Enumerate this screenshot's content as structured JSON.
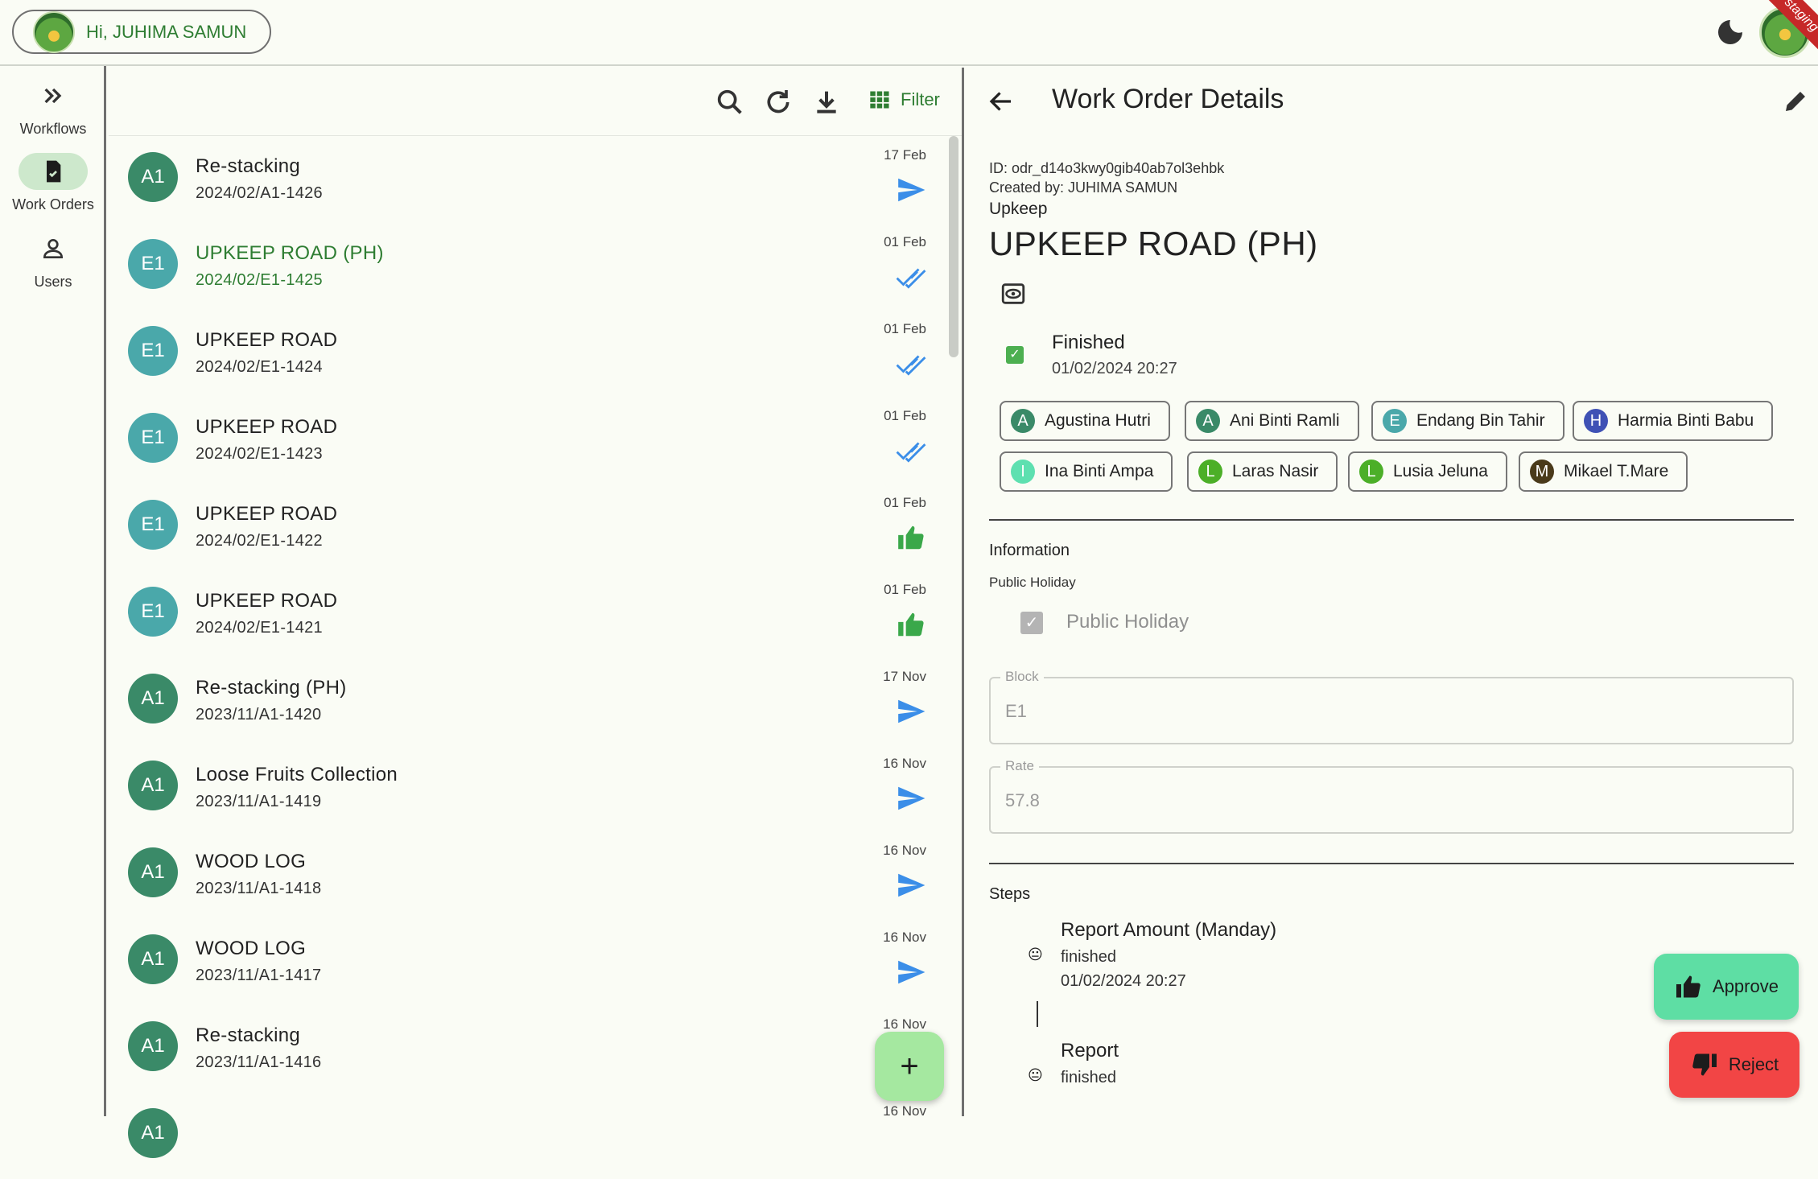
{
  "header": {
    "greeting": "Hi, JUHIMA SAMUN",
    "env_badge": "staging"
  },
  "rail": {
    "items": [
      {
        "label": "Workflows",
        "icon": "double-chevron-right-icon"
      },
      {
        "label": "Work Orders",
        "icon": "clipboard-check-icon",
        "active": true
      },
      {
        "label": "Users",
        "icon": "person-icon"
      }
    ]
  },
  "toolbar": {
    "filter_label": "Filter"
  },
  "orders": [
    {
      "avatar": "A1",
      "title": "Re-stacking",
      "code": "2024/02/A1-1426",
      "date": "17 Feb",
      "status": "send"
    },
    {
      "avatar": "E1",
      "title": "UPKEEP ROAD (PH)",
      "code": "2024/02/E1-1425",
      "date": "01 Feb",
      "status": "done-all",
      "selected": true
    },
    {
      "avatar": "E1",
      "title": "UPKEEP ROAD",
      "code": "2024/02/E1-1424",
      "date": "01 Feb",
      "status": "done-all"
    },
    {
      "avatar": "E1",
      "title": "UPKEEP ROAD",
      "code": "2024/02/E1-1423",
      "date": "01 Feb",
      "status": "done-all"
    },
    {
      "avatar": "E1",
      "title": "UPKEEP ROAD",
      "code": "2024/02/E1-1422",
      "date": "01 Feb",
      "status": "thumb-up"
    },
    {
      "avatar": "E1",
      "title": "UPKEEP ROAD",
      "code": "2024/02/E1-1421",
      "date": "01 Feb",
      "status": "thumb-up"
    },
    {
      "avatar": "A1",
      "title": "Re-stacking (PH)",
      "code": "2023/11/A1-1420",
      "date": "17 Nov",
      "status": "send"
    },
    {
      "avatar": "A1",
      "title": "Loose Fruits Collection",
      "code": "2023/11/A1-1419",
      "date": "16 Nov",
      "status": "send"
    },
    {
      "avatar": "A1",
      "title": "WOOD LOG",
      "code": "2023/11/A1-1418",
      "date": "16 Nov",
      "status": "send"
    },
    {
      "avatar": "A1",
      "title": "WOOD LOG",
      "code": "2023/11/A1-1417",
      "date": "16 Nov",
      "status": "send"
    },
    {
      "avatar": "A1",
      "title": "Re-stacking",
      "code": "2023/11/A1-1416",
      "date": "16 Nov",
      "status": "none"
    },
    {
      "avatar": "A1",
      "title": "",
      "code": "",
      "date": "16 Nov",
      "status": "none"
    }
  ],
  "detail": {
    "header_title": "Work Order Details",
    "id_line": "ID: odr_d14o3kwy0gib40ab7ol3ehbk",
    "created_line": "Created by: JUHIMA SAMUN",
    "category": "Upkeep",
    "title": "UPKEEP ROAD (PH)",
    "status_label": "Finished",
    "status_time": "01/02/2024 20:27",
    "workers": [
      {
        "initial": "A",
        "name": "Agustina Hutri",
        "color": "#3a8a68"
      },
      {
        "initial": "A",
        "name": "Ani Binti Ramli",
        "color": "#3a8a68"
      },
      {
        "initial": "E",
        "name": "Endang Bin Tahir",
        "color": "#4aa8aa"
      },
      {
        "initial": "H",
        "name": "Harmia Binti Babu",
        "color": "#3f51b5"
      },
      {
        "initial": "I",
        "name": "Ina Binti Ampa",
        "color": "#5ee0b0"
      },
      {
        "initial": "L",
        "name": "Laras Nasir",
        "color": "#4caf28"
      },
      {
        "initial": "L",
        "name": "Lusia Jeluna",
        "color": "#4caf28"
      },
      {
        "initial": "M",
        "name": "Mikael T.Mare",
        "color": "#4a3a1a"
      }
    ],
    "info_heading": "Information",
    "public_holiday_label": "Public Holiday",
    "public_holiday_checkbox": "Public Holiday",
    "block_label": "Block",
    "block_value": "E1",
    "rate_label": "Rate",
    "rate_value": "57.8",
    "steps_heading": "Steps",
    "steps": [
      {
        "title": "Report Amount (Manday)",
        "status": "finished",
        "time": "01/02/2024 20:27"
      },
      {
        "title": "Report",
        "status": "finished",
        "time": ""
      }
    ],
    "approve_label": "Approve",
    "reject_label": "Reject"
  }
}
